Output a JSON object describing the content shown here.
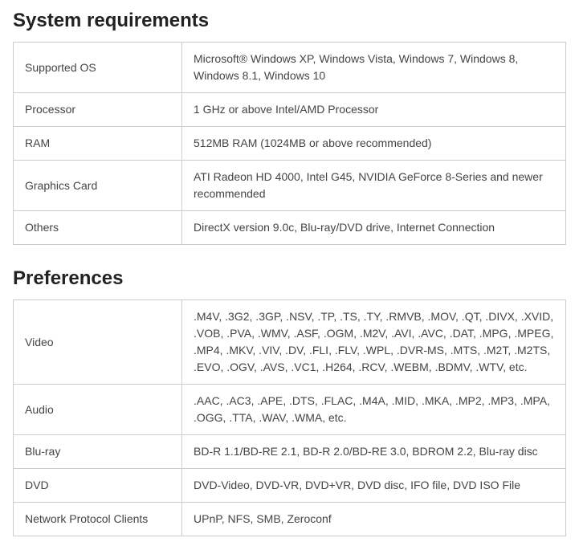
{
  "sections": [
    {
      "title": "System requirements",
      "rows": [
        {
          "label": "Supported OS",
          "value": "Microsoft® Windows XP, Windows Vista, Windows 7, Windows 8, Windows 8.1, Windows 10"
        },
        {
          "label": "Processor",
          "value": "1 GHz or above Intel/AMD Processor"
        },
        {
          "label": "RAM",
          "value": "512MB RAM (1024MB or above recommended)"
        },
        {
          "label": "Graphics Card",
          "value": "ATI Radeon HD 4000, Intel G45, NVIDIA GeForce 8-Series and newer recommended"
        },
        {
          "label": "Others",
          "value": "DirectX version 9.0c, Blu-ray/DVD drive, Internet Connection"
        }
      ]
    },
    {
      "title": "Preferences",
      "rows": [
        {
          "label": "Video",
          "value": ".M4V, .3G2, .3GP, .NSV, .TP, .TS, .TY, .RMVB, .MOV, .QT, .DIVX, .XVID, .VOB, .PVA, .WMV, .ASF, .OGM, .M2V, .AVI, .AVC, .DAT, .MPG, .MPEG, .MP4, .MKV, .VIV, .DV, .FLI, .FLV, .WPL, .DVR-MS, .MTS, .M2T, .M2TS, .EVO, .OGV, .AVS, .VC1, .H264, .RCV, .WEBM, .BDMV, .WTV, etc."
        },
        {
          "label": "Audio",
          "value": ".AAC, .AC3, .APE, .DTS, .FLAC, .M4A, .MID, .MKA, .MP2, .MP3, .MPA, .OGG, .TTA, .WAV, .WMA, etc."
        },
        {
          "label": "Blu-ray",
          "value": "BD-R 1.1/BD-RE 2.1, BD-R 2.0/BD-RE 3.0, BDROM 2.2, Blu-ray disc"
        },
        {
          "label": "DVD",
          "value": "DVD-Video, DVD-VR, DVD+VR, DVD disc, IFO file, DVD ISO File"
        },
        {
          "label": "Network Protocol Clients",
          "value": "UPnP, NFS, SMB, Zeroconf"
        }
      ]
    }
  ]
}
